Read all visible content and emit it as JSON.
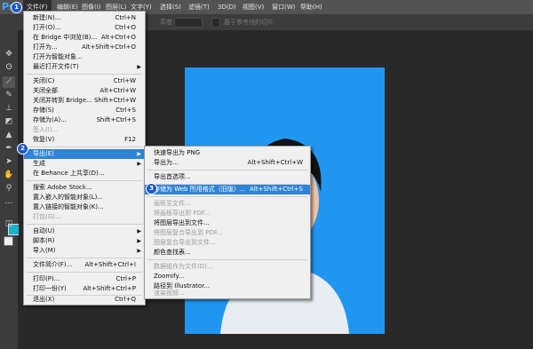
{
  "app": {
    "logo": "Ps"
  },
  "menubar": [
    {
      "label": "文件(F)"
    },
    {
      "label": "编辑(E)"
    },
    {
      "label": "图像(I)"
    },
    {
      "label": "图层(L)"
    },
    {
      "label": "文字(Y)"
    },
    {
      "label": "选择(S)"
    },
    {
      "label": "滤镜(T)"
    },
    {
      "label": "3D(D)"
    },
    {
      "label": "视图(V)"
    },
    {
      "label": "窗口(W)"
    },
    {
      "label": "帮助(H)"
    }
  ],
  "options": {
    "height_label": "高度",
    "guides_label": "基于参考线的切片"
  },
  "file_menu": [
    {
      "label": "新建(N)...",
      "shortcut": "Ctrl+N"
    },
    {
      "label": "打开(O)...",
      "shortcut": "Ctrl+O"
    },
    {
      "label": "在 Bridge 中浏览(B)...",
      "shortcut": "Alt+Ctrl+O"
    },
    {
      "label": "打开为...",
      "shortcut": "Alt+Shift+Ctrl+O"
    },
    {
      "label": "打开为智能对象...",
      "shortcut": ""
    },
    {
      "label": "最近打开文件(T)",
      "shortcut": ""
    },
    {
      "label": "关闭(C)",
      "shortcut": "Ctrl+W"
    },
    {
      "label": "关闭全部",
      "shortcut": "Alt+Ctrl+W"
    },
    {
      "label": "关闭并转到 Bridge...",
      "shortcut": "Shift+Ctrl+W"
    },
    {
      "label": "存储(S)",
      "shortcut": "Ctrl+S"
    },
    {
      "label": "存储为(A)...",
      "shortcut": "Shift+Ctrl+S"
    },
    {
      "label": "签入(I)...",
      "shortcut": ""
    },
    {
      "label": "恢复(V)",
      "shortcut": "F12"
    },
    {
      "label": "导出(E)",
      "shortcut": ""
    },
    {
      "label": "生成",
      "shortcut": ""
    },
    {
      "label": "在 Behance 上共享(D)...",
      "shortcut": ""
    },
    {
      "label": "搜索 Adobe Stock...",
      "shortcut": ""
    },
    {
      "label": "置入嵌入的智能对象(L)...",
      "shortcut": ""
    },
    {
      "label": "置入链接的智能对象(K)...",
      "shortcut": ""
    },
    {
      "label": "打包(G)...",
      "shortcut": ""
    },
    {
      "label": "自动(U)",
      "shortcut": ""
    },
    {
      "label": "脚本(R)",
      "shortcut": ""
    },
    {
      "label": "导入(M)",
      "shortcut": ""
    },
    {
      "label": "文件简介(F)...",
      "shortcut": "Alt+Shift+Ctrl+I"
    },
    {
      "label": "打印(P)...",
      "shortcut": "Ctrl+P"
    },
    {
      "label": "打印一份(Y)",
      "shortcut": "Alt+Shift+Ctrl+P"
    },
    {
      "label": "退出(X)",
      "shortcut": "Ctrl+Q"
    }
  ],
  "export_menu": [
    {
      "label": "快速导出为 PNG",
      "shortcut": ""
    },
    {
      "label": "导出为...",
      "shortcut": "Alt+Shift+Ctrl+W"
    },
    {
      "label": "导出首选项...",
      "shortcut": ""
    },
    {
      "label": "存储为 Web 所用格式（旧版）...",
      "shortcut": "Alt+Shift+Ctrl+S"
    },
    {
      "label": "画板至文件...",
      "shortcut": ""
    },
    {
      "label": "将画板导出到 PDF...",
      "shortcut": ""
    },
    {
      "label": "将图层导出到文件...",
      "shortcut": ""
    },
    {
      "label": "将图层复合导出到 PDF...",
      "shortcut": ""
    },
    {
      "label": "图层复合导出到文件...",
      "shortcut": ""
    },
    {
      "label": "颜色查找表...",
      "shortcut": ""
    },
    {
      "label": "数据组作为文件(D)...",
      "shortcut": ""
    },
    {
      "label": "Zoomify...",
      "shortcut": ""
    },
    {
      "label": "路径到 Illustrator...",
      "shortcut": ""
    },
    {
      "label": "渲染视频...",
      "shortcut": ""
    }
  ],
  "badges": [
    "1",
    "2",
    "3"
  ],
  "colors": {
    "highlight": "#2f84d6",
    "photo_bg": "#2196f0",
    "badge": "#1f58c6",
    "foreground_swatch": "#17b3cc"
  }
}
